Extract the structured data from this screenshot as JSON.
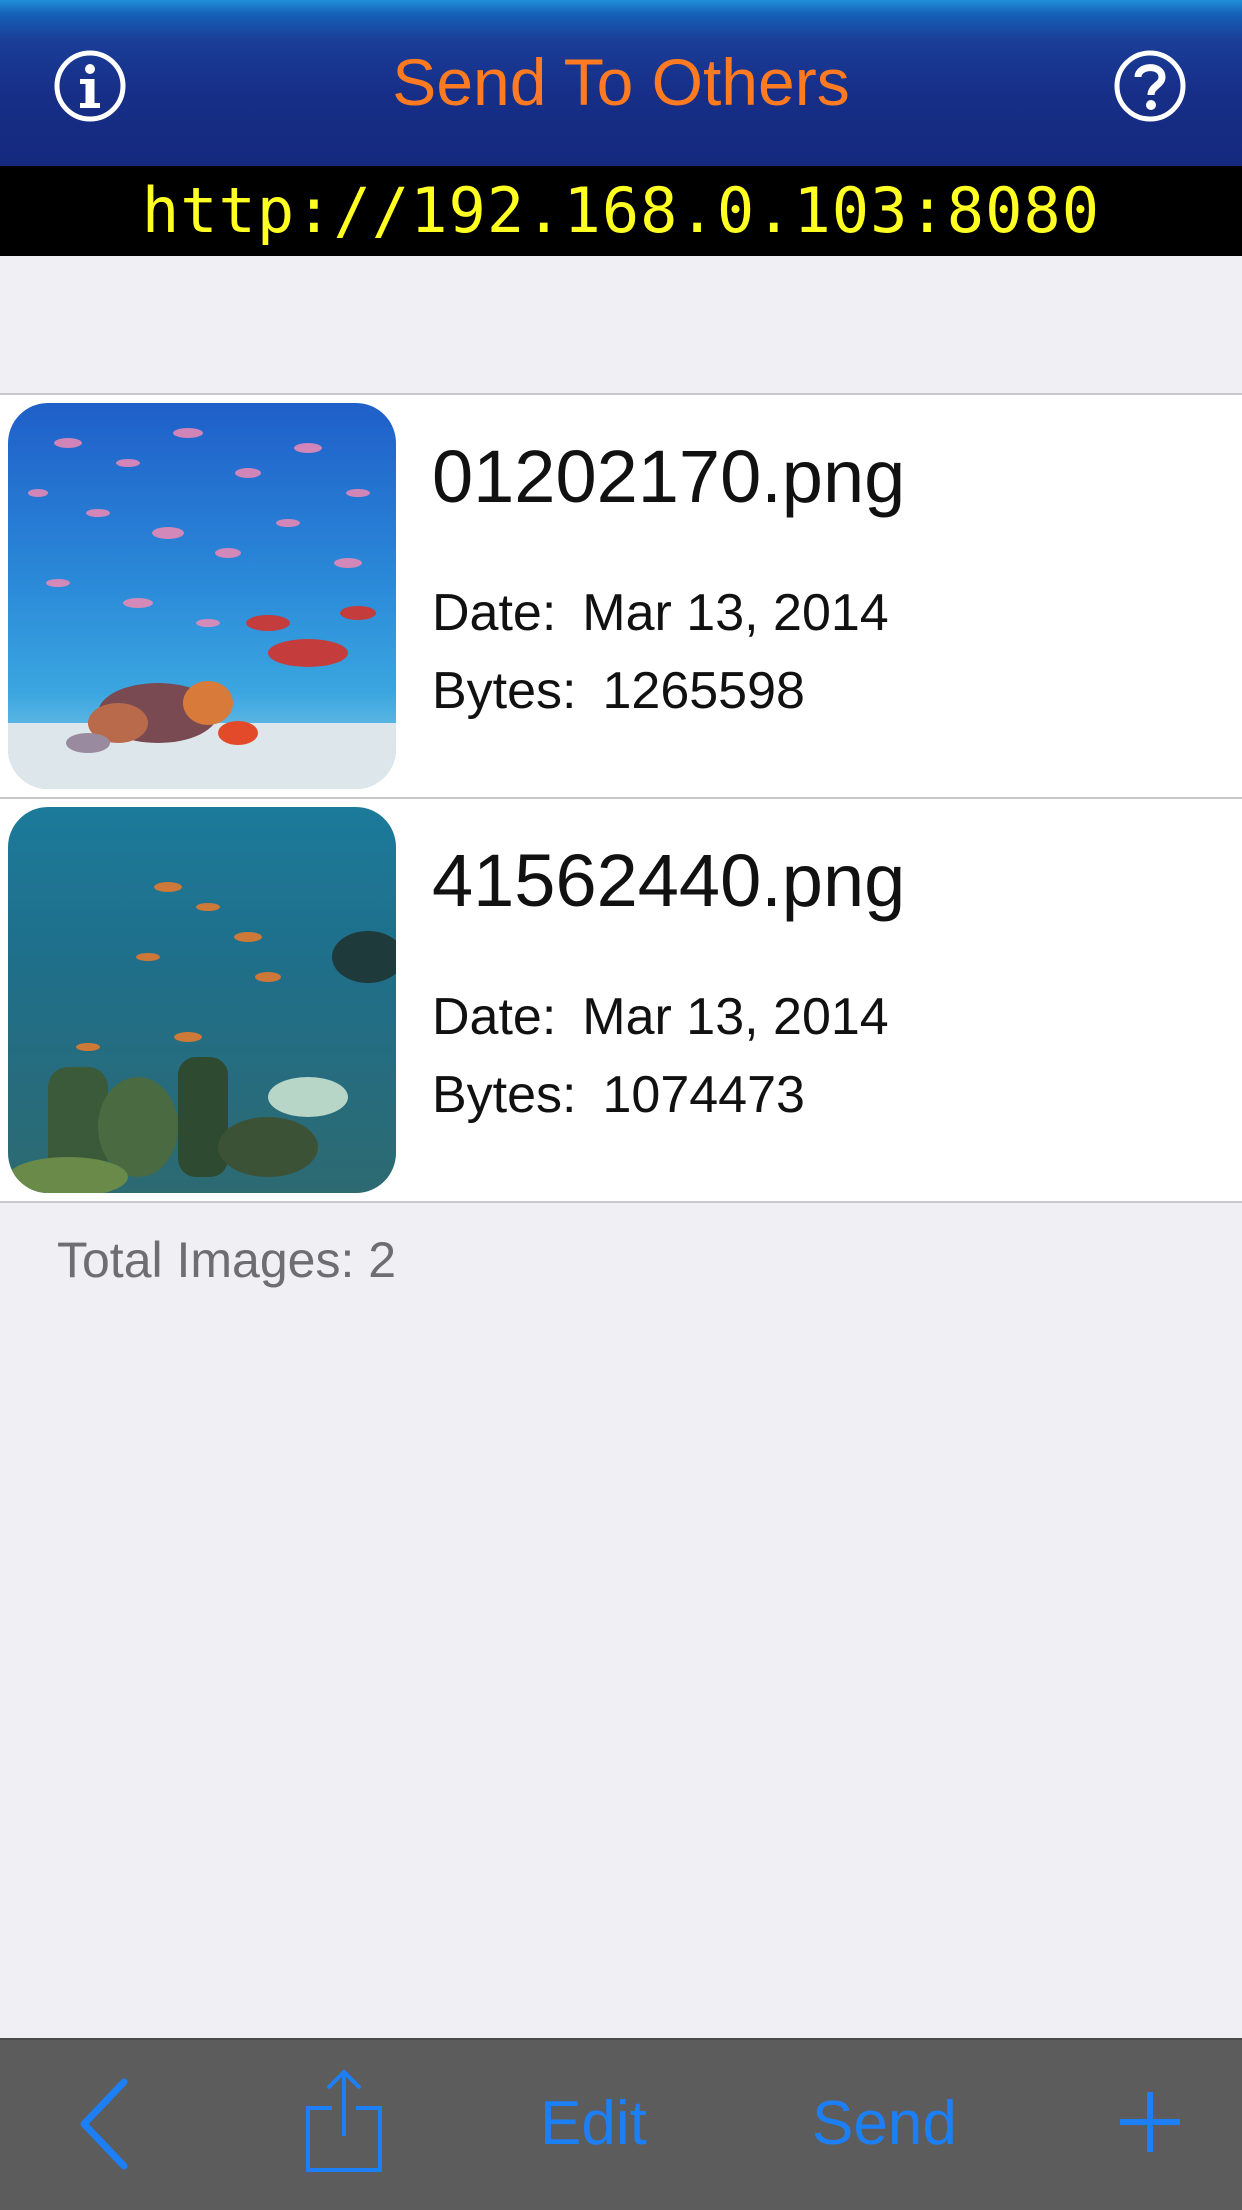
{
  "header": {
    "title": "Send To Others",
    "info_icon": "info-circle-icon",
    "help_icon": "question-circle-icon"
  },
  "server": {
    "url": "http://192.168.0.103:8080"
  },
  "files": [
    {
      "name": "01202170.png",
      "date_label": "Date:",
      "date": "Mar 13, 2014",
      "bytes_label": "Bytes:",
      "bytes": "1265598"
    },
    {
      "name": "41562440.png",
      "date_label": "Date:",
      "date": "Mar 13, 2014",
      "bytes_label": "Bytes:",
      "bytes": "1074473"
    }
  ],
  "footer": {
    "total": "Total Images: 2"
  },
  "toolbar": {
    "back_icon": "chevron-left-icon",
    "share_icon": "share-icon",
    "edit_label": "Edit",
    "send_label": "Send",
    "add_icon": "plus-icon"
  },
  "colors": {
    "title": "#ff7a21",
    "url": "#ffff22",
    "accent": "#1d7ff5",
    "navbar": "#172f88",
    "toolbar": "#5c5c5c"
  }
}
